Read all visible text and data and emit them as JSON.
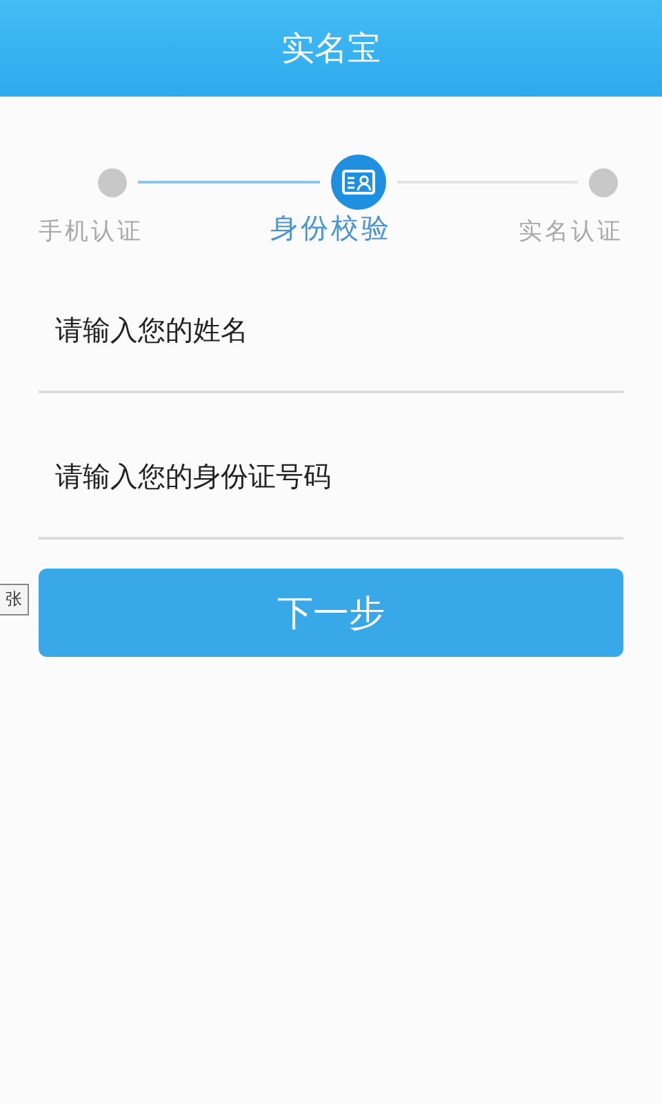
{
  "header": {
    "title": "实名宝"
  },
  "steps": [
    {
      "label": "手机认证",
      "selected": false
    },
    {
      "label": "身份校验",
      "selected": true
    },
    {
      "label": "实名认证",
      "selected": false
    }
  ],
  "fields": [
    {
      "placeholder": "请输入您的姓名"
    },
    {
      "placeholder": "请输入您的身份证号码"
    }
  ],
  "next_button": {
    "label": "下一步"
  },
  "tooltip": {
    "text": "张"
  }
}
